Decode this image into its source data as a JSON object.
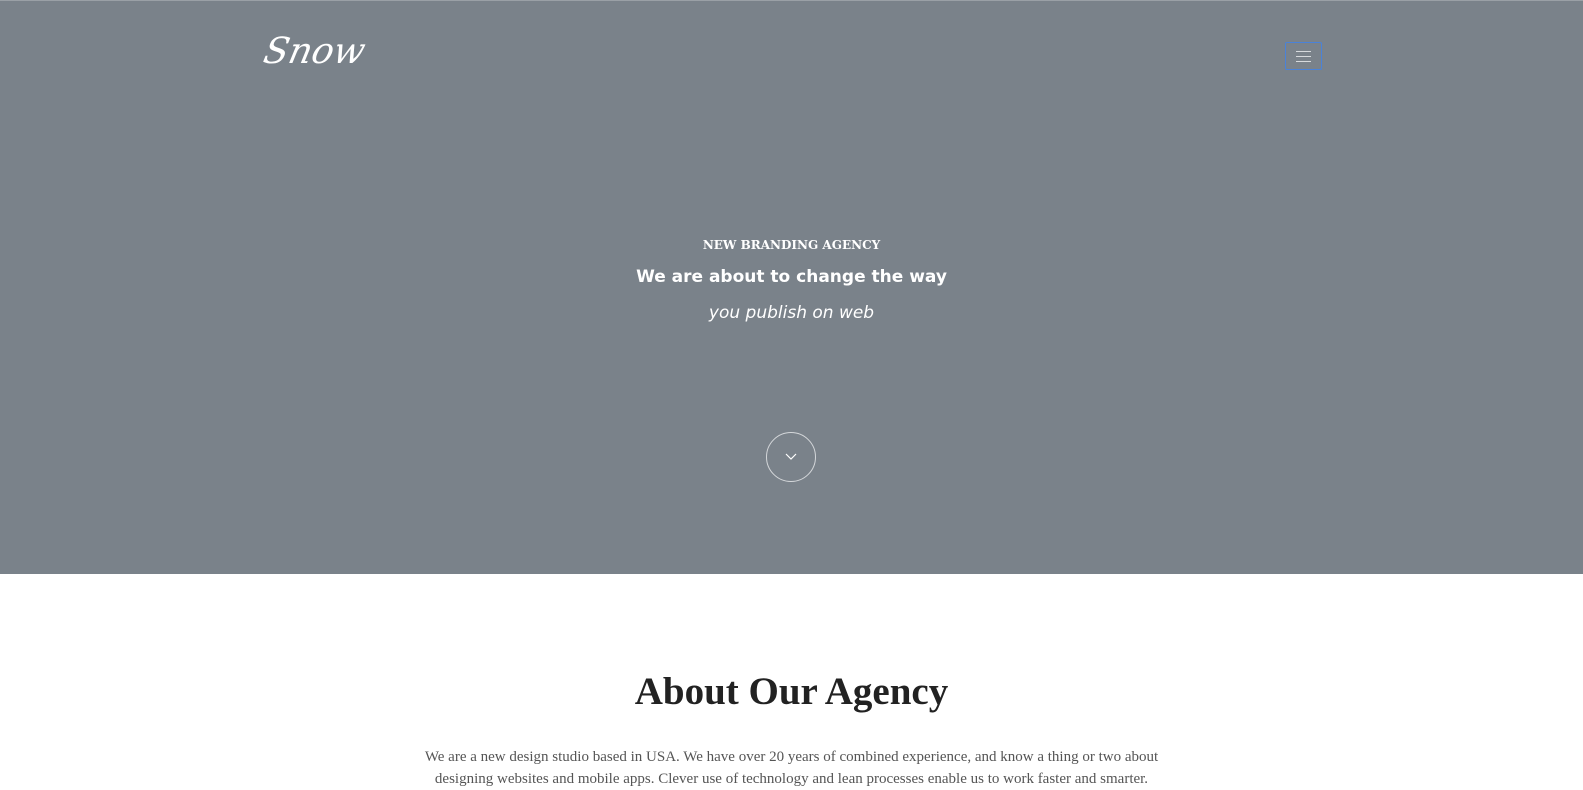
{
  "header": {
    "logo": "Snow",
    "menu_icon": "hamburger-menu-icon",
    "menu_border_color": "#4a82d8"
  },
  "hero": {
    "background_color": "#7a828a",
    "eyebrow": "NEW BRANDING AGENCY",
    "headline": "We are about to change the way",
    "subline": "you publish on web",
    "scroll_icon": "chevron-down-icon"
  },
  "about": {
    "title": "About Our Agency",
    "text": "We are a new design studio based in USA. We have over 20 years of combined experience, and know a thing or two about designing websites and mobile apps. Clever use of technology and lean processes enable us to work faster and smarter."
  }
}
